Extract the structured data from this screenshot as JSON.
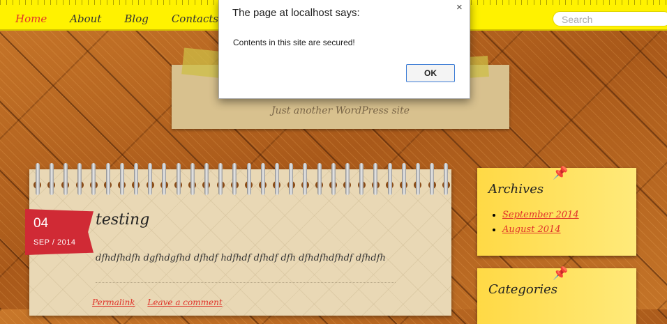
{
  "nav": {
    "items": [
      {
        "label": "Home",
        "active": true
      },
      {
        "label": "About"
      },
      {
        "label": "Blog"
      },
      {
        "label": "Contacts"
      }
    ],
    "search_placeholder": "Search"
  },
  "header": {
    "tagline": "Just another WordPress site"
  },
  "post": {
    "day": "04",
    "month_year": "SEP / 2014",
    "title": "testing",
    "body": "dfhdfhdfh dgfhdgfhd dfhdf hdfhdf dfhdf dfh dfhdfhdfhdf dfhdfh",
    "permalink_label": "Permalink",
    "comment_label": "Leave a comment"
  },
  "sidebar": {
    "archives": {
      "title": "Archives",
      "items": [
        "September 2014",
        "August 2014"
      ]
    },
    "categories": {
      "title": "Categories"
    }
  },
  "dialog": {
    "title": "The page at localhost says:",
    "message": "Contents in this site are secured!",
    "ok_label": "OK",
    "close_glyph": "×"
  },
  "colors": {
    "nav_bg": "#fff200",
    "accent": "#e0332a",
    "ribbon": "#d02a35",
    "widget_bg": "#ffd945"
  }
}
